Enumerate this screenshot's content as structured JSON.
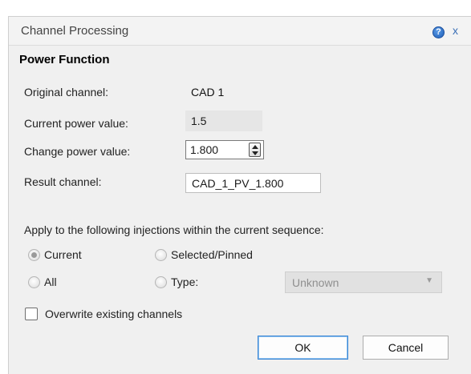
{
  "window": {
    "title": "Channel Processing",
    "help_glyph": "?",
    "close_glyph": "x"
  },
  "section_header": "Power Function",
  "fields": {
    "original_channel_label": "Original channel:",
    "original_channel_value": "CAD  1",
    "current_power_label": "Current power value:",
    "current_power_value": "1.5",
    "change_power_label": "Change power value:",
    "change_power_value": "1.800",
    "result_channel_label": "Result channel:",
    "result_channel_value": "CAD_1_PV_1.800"
  },
  "apply": {
    "label": "Apply to the following injections within the current sequence:",
    "options": [
      {
        "label": "Current",
        "checked": true
      },
      {
        "label": "Selected/Pinned",
        "checked": false
      },
      {
        "label": "All",
        "checked": false
      },
      {
        "label": "Type:",
        "checked": false
      }
    ],
    "type_select_value": "Unknown",
    "type_select_arrow": "▼"
  },
  "overwrite": {
    "label": "Overwrite existing channels",
    "checked": false
  },
  "buttons": {
    "ok": "OK",
    "cancel": "Cancel"
  },
  "colors": {
    "dialog_bg": "#f0f0f0",
    "default_button_border": "#3c86d4",
    "help_icon": "#1f5fb8"
  }
}
